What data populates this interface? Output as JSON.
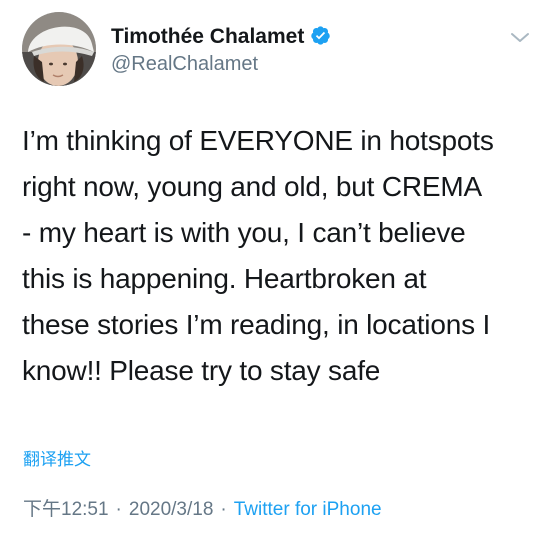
{
  "tweet": {
    "author": {
      "display_name": "Timothée Chalamet",
      "handle": "@RealChalamet",
      "verified": true,
      "avatar_icon": "user-avatar-photo"
    },
    "text": "I’m thinking of EVERYONE in hotspots\nright now, young and old, but CREMA\n- my heart is with you, I can’t believe\nthis is happening. Heartbroken at\nthese stories I’m reading, in locations I\nknow!! Please try to stay safe",
    "translate_label": "翻译推文",
    "time": "下午12:51",
    "separator": "·",
    "date": "2020/3/18",
    "source": "Twitter for iPhone"
  },
  "colors": {
    "text": "#14171a",
    "secondary": "#657786",
    "link": "#1da1f2",
    "verified_badge": "#1da1f2"
  },
  "icons": {
    "verified": "verified-badge-icon",
    "menu": "chevron-down-icon"
  }
}
